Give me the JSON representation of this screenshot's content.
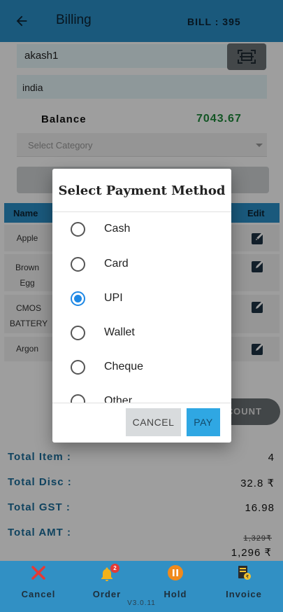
{
  "header": {
    "title": "Billing",
    "bill_number": "BILL : 395"
  },
  "customer": {
    "name": "akash1",
    "country": "india"
  },
  "balance": {
    "label": "Balance",
    "value": "7043.67"
  },
  "category": {
    "placeholder": "Select Category"
  },
  "table": {
    "headers": {
      "name": "Name",
      "edit": "Edit"
    },
    "rows": [
      {
        "name": "Apple"
      },
      {
        "name": "Brown Egg"
      },
      {
        "name": "CMOS BATTERY"
      },
      {
        "name": "Argon"
      }
    ]
  },
  "discount_button": {
    "label": "COUNT"
  },
  "totals": {
    "items": {
      "label": "Total Item :",
      "value": "4"
    },
    "disc": {
      "label": "Total Disc :",
      "value": "32.8 ₹"
    },
    "gst": {
      "label": "Total GST :",
      "value": "16.98"
    },
    "amt": {
      "label": "Total AMT :",
      "original": "1,329₹",
      "value": "1,296 ₹"
    }
  },
  "dialog": {
    "title": "Select Payment Method",
    "options": [
      {
        "label": "Cash",
        "selected": false
      },
      {
        "label": "Card",
        "selected": false
      },
      {
        "label": "UPI",
        "selected": true
      },
      {
        "label": "Wallet",
        "selected": false
      },
      {
        "label": "Cheque",
        "selected": false
      },
      {
        "label": "Other",
        "selected": false
      }
    ],
    "cancel_label": "CANCEL",
    "pay_label": "PAY"
  },
  "bottom_nav": {
    "items": [
      {
        "label": "Cancel",
        "icon": "close-x-icon"
      },
      {
        "label": "Order",
        "icon": "bell-icon",
        "badge": "2"
      },
      {
        "label": "Hold",
        "icon": "pause-icon"
      },
      {
        "label": "Invoice",
        "icon": "invoice-icon"
      }
    ],
    "version": "V3.0.11"
  },
  "colors": {
    "primary": "#2b90c8",
    "balance_green": "#1d8a3a",
    "radio_selected": "#1e88e5",
    "pay_button": "#2fa7e3",
    "cancel_icon": "#e53935",
    "bell_icon": "#f2b21a",
    "hold_icon": "#f08a1c"
  }
}
